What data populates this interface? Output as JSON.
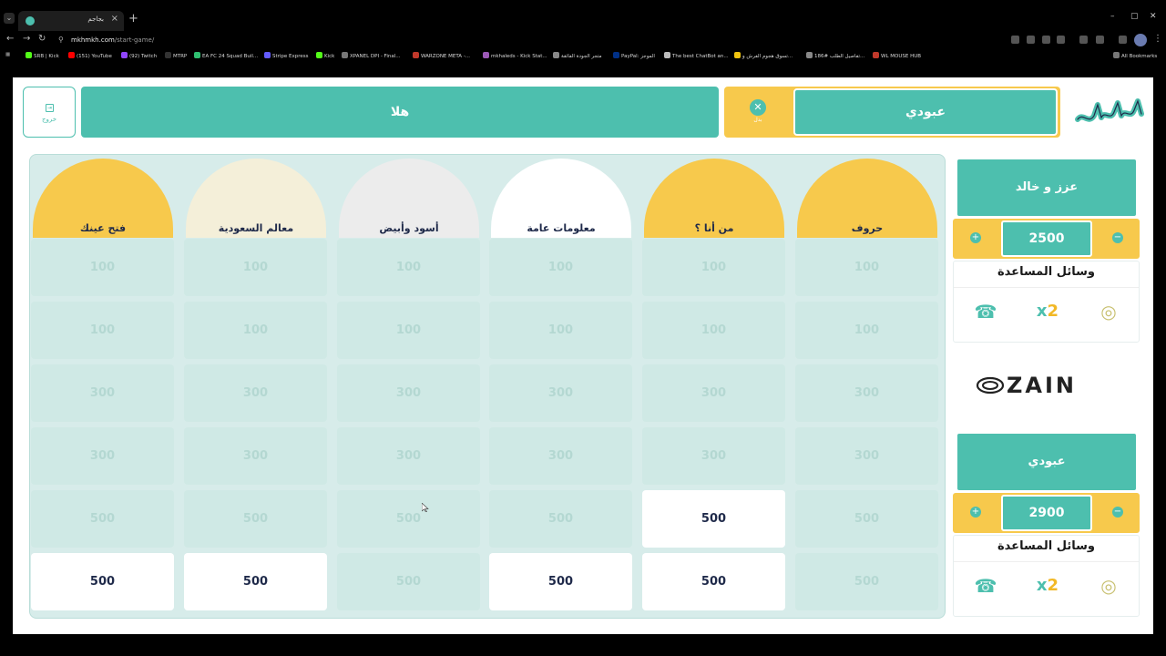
{
  "browser": {
    "tab_title": "بجاجم",
    "url_host": "mkhmkh.com",
    "url_path": "/start-game/",
    "bookmarks": [
      {
        "label": "SRB | Kick",
        "color": "#53fc18"
      },
      {
        "label": "(151) YouTube",
        "color": "#ff0000"
      },
      {
        "label": "(92) Twitch",
        "color": "#9146ff"
      },
      {
        "label": "MTRP",
        "color": "#333333"
      },
      {
        "label": "EA FC 24 Squad Buil...",
        "color": "#2fbf71"
      },
      {
        "label": "Stripe Express",
        "color": "#635bff"
      },
      {
        "label": "Kick",
        "color": "#53fc18"
      },
      {
        "label": "XPANEL DPI - Final...",
        "color": "#777777"
      },
      {
        "label": "WARZONE META -...",
        "color": "#c0392b"
      },
      {
        "label": "mkhaleds - Kick Stat...",
        "color": "#9b59b6"
      },
      {
        "label": "متجر الجودة الفائقة",
        "color": "#888888"
      },
      {
        "label": "PayPal: الموجز",
        "color": "#003087"
      },
      {
        "label": "The best ChatBot an...",
        "color": "#bbbbbb"
      },
      {
        "label": "تسوق هجوم الفرش و...",
        "color": "#f1c40f"
      },
      {
        "label": "تفاصيل الطلب #186...",
        "color": "#888888"
      },
      {
        "label": "WL MOUSE HUB",
        "color": "#c0392b"
      }
    ],
    "all_bookmarks": "All Bookmarks"
  },
  "header": {
    "exit_label": "خروج",
    "team_left": "هلا",
    "turn_label": "بدل",
    "team_right": "عبودي"
  },
  "board": {
    "categories": [
      {
        "name": "فتح عينك",
        "bg": "#f7c94c"
      },
      {
        "name": "معالم السعودية",
        "bg": "#f4efd9"
      },
      {
        "name": "أسود وأبيض",
        "bg": "#ececec"
      },
      {
        "name": "معلومات عامة",
        "bg": "#ffffff"
      },
      {
        "name": "من أنا ؟",
        "bg": "#f7c94c"
      },
      {
        "name": "حروف",
        "bg": "#f7c94c"
      }
    ],
    "rows": [
      [
        {
          "v": "100",
          "open": false
        },
        {
          "v": "100",
          "open": false
        },
        {
          "v": "100",
          "open": false
        },
        {
          "v": "100",
          "open": false
        },
        {
          "v": "100",
          "open": false
        },
        {
          "v": "100",
          "open": false
        }
      ],
      [
        {
          "v": "100",
          "open": false
        },
        {
          "v": "100",
          "open": false
        },
        {
          "v": "100",
          "open": false
        },
        {
          "v": "100",
          "open": false
        },
        {
          "v": "100",
          "open": false
        },
        {
          "v": "100",
          "open": false
        }
      ],
      [
        {
          "v": "300",
          "open": false
        },
        {
          "v": "300",
          "open": false
        },
        {
          "v": "300",
          "open": false
        },
        {
          "v": "300",
          "open": false
        },
        {
          "v": "300",
          "open": false
        },
        {
          "v": "300",
          "open": false
        }
      ],
      [
        {
          "v": "300",
          "open": false
        },
        {
          "v": "300",
          "open": false
        },
        {
          "v": "300",
          "open": false
        },
        {
          "v": "300",
          "open": false
        },
        {
          "v": "300",
          "open": false
        },
        {
          "v": "300",
          "open": false
        }
      ],
      [
        {
          "v": "500",
          "open": false
        },
        {
          "v": "500",
          "open": false
        },
        {
          "v": "500",
          "open": false
        },
        {
          "v": "500",
          "open": false
        },
        {
          "v": "500",
          "open": true
        },
        {
          "v": "500",
          "open": false
        }
      ],
      [
        {
          "v": "500",
          "open": true
        },
        {
          "v": "500",
          "open": true
        },
        {
          "v": "500",
          "open": false
        },
        {
          "v": "500",
          "open": true
        },
        {
          "v": "500",
          "open": true
        },
        {
          "v": "500",
          "open": false
        }
      ]
    ]
  },
  "teams": [
    {
      "name": "عزز و خالد",
      "score": "2500",
      "aids_title": "وسائل المساعدة"
    },
    {
      "name": "عبودي",
      "score": "2900",
      "aids_title": "وسائل المساعدة"
    }
  ],
  "sponsor": "ZAIN",
  "colors": {
    "teal": "#4dbfae",
    "yellow": "#f7c94c",
    "navy": "#1f2a4a"
  }
}
